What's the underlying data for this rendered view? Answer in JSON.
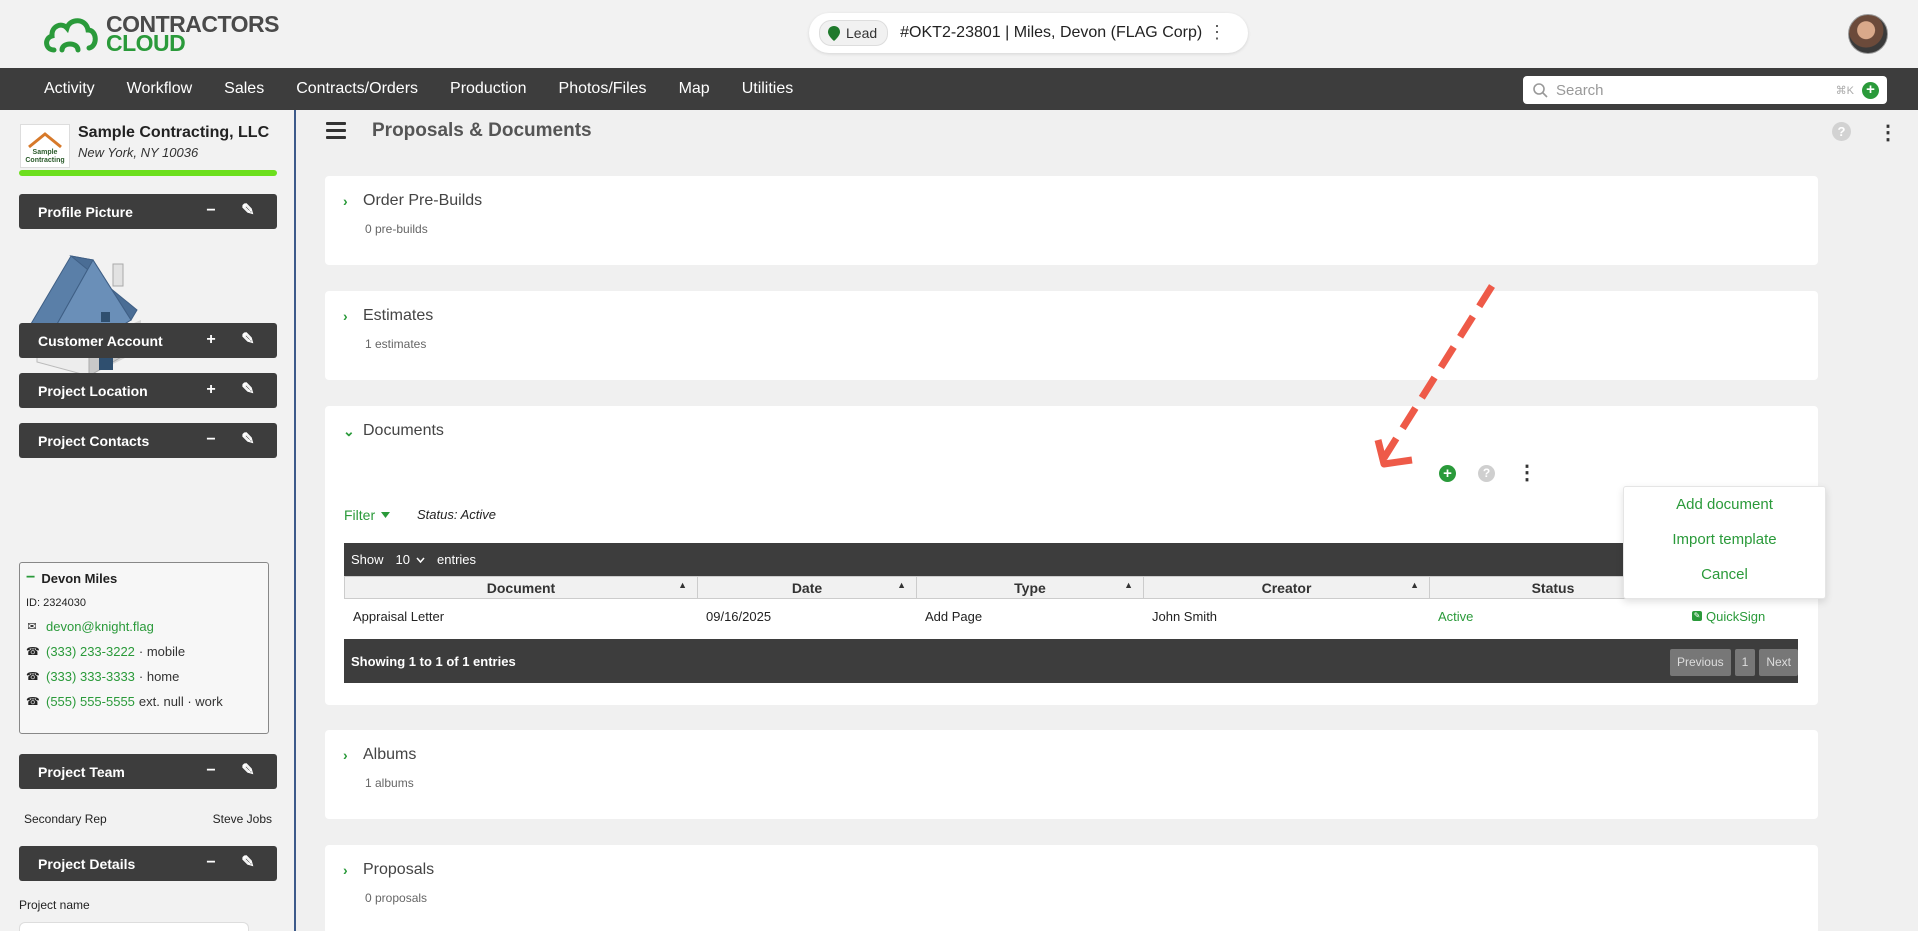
{
  "brand": {
    "line1": "CONTRACTORS",
    "line2": "CLOUD"
  },
  "job": {
    "badge": "Lead",
    "title": "#OKT2-23801 | Miles, Devon (FLAG Corp)",
    "more": "⋮"
  },
  "nav": [
    "Activity",
    "Workflow",
    "Sales",
    "Contracts/Orders",
    "Production",
    "Photos/Files",
    "Map",
    "Utilities"
  ],
  "search": {
    "placeholder": "Search",
    "shortcut": "⌘K",
    "add": "+"
  },
  "company": {
    "logo_text_1": "Sample",
    "logo_text_2": "Contracting",
    "name": "Sample Contracting, LLC",
    "location": "New York, NY 10036",
    "progress": 1.0
  },
  "panels": {
    "profile_picture": "Profile Picture",
    "customer_account": "Customer Account",
    "project_location": "Project Location",
    "project_contacts": "Project Contacts",
    "project_team": "Project Team",
    "project_details": "Project Details"
  },
  "panel_buttons": {
    "minus": "−",
    "plus": "+",
    "edit": "✎"
  },
  "contact": {
    "name": "Devon Miles",
    "id": "ID: 2324030",
    "email": "devon@knight.flag",
    "phones": [
      {
        "number": "(333) 233-3222",
        "label": "· mobile"
      },
      {
        "number": "(333) 333-3333",
        "label": "· home"
      },
      {
        "number": "(555) 555-5555",
        "label": "ext. null · work"
      }
    ]
  },
  "team": {
    "role": "Secondary Rep",
    "person": "Steve Jobs"
  },
  "details": {
    "label": "Project name"
  },
  "page": {
    "title": "Proposals & Documents",
    "help": "?",
    "more": "⋮"
  },
  "sections": {
    "prebuilds": {
      "title": "Order Pre-Builds",
      "sub": "0 pre-builds"
    },
    "estimates": {
      "title": "Estimates",
      "sub": "1 estimates"
    },
    "documents": {
      "title": "Documents"
    },
    "albums": {
      "title": "Albums",
      "sub": "1 albums"
    },
    "proposals": {
      "title": "Proposals",
      "sub": "0 proposals"
    }
  },
  "documents": {
    "filter": "Filter",
    "status_filter": "Status: Active",
    "show": "Show",
    "entries_count": "10",
    "entries": "entries",
    "columns": [
      "Document",
      "Date",
      "Type",
      "Creator",
      "Status"
    ],
    "rows": [
      {
        "document": "Appraisal Letter",
        "date": "09/16/2025",
        "type": "Add Page",
        "creator": "John Smith",
        "status": "Active",
        "action": "QuickSign"
      }
    ],
    "summary": "Showing 1 to 1 of 1 entries",
    "pager": {
      "prev": "Previous",
      "page": "1",
      "next": "Next"
    },
    "menu": [
      "Add document",
      "Import template",
      "Cancel"
    ]
  },
  "colors": {
    "accent": "#2a9a3a",
    "nav": "#3d3d3d",
    "annotation_arrow": "#ee5a48"
  }
}
